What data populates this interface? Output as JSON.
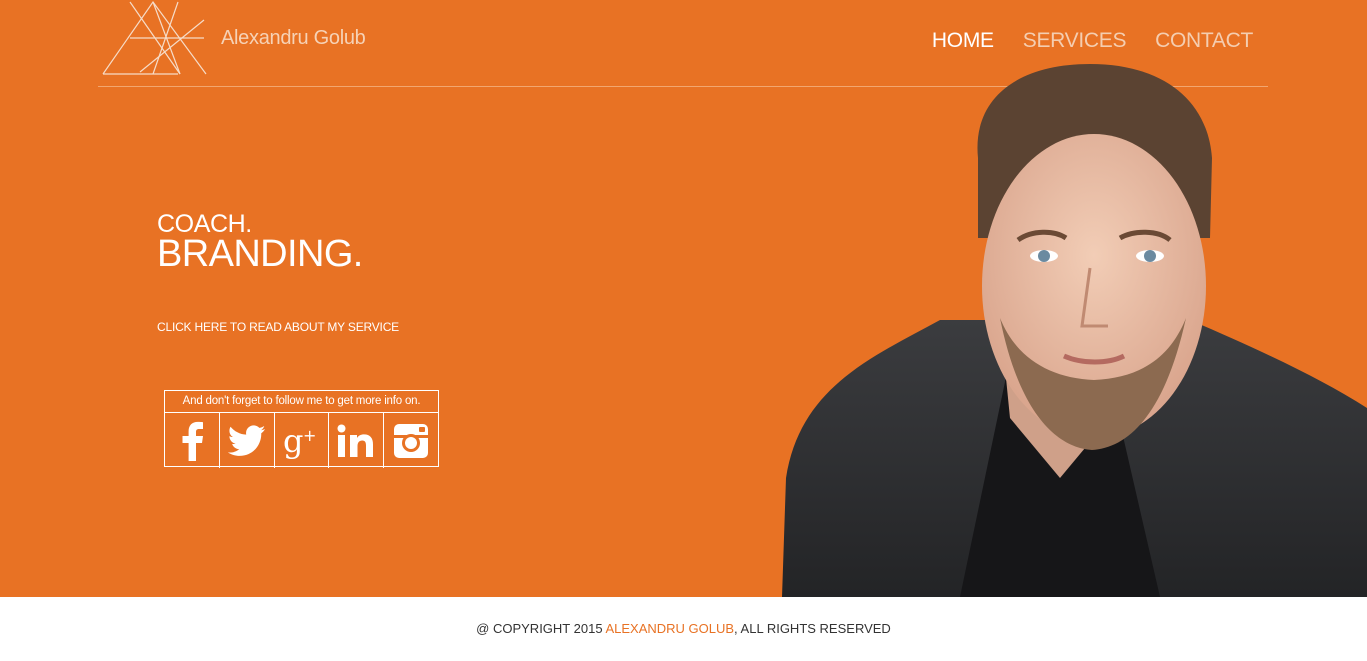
{
  "brand": {
    "name": "Alexandru Golub",
    "logo_icon": "ag-monogram-logo"
  },
  "nav": {
    "items": [
      {
        "label": "HOME",
        "active": true
      },
      {
        "label": "SERVICES",
        "active": false
      },
      {
        "label": "CONTACT",
        "active": false
      }
    ]
  },
  "hero": {
    "tagline_1": "COACH.",
    "tagline_2": "BRANDING.",
    "cta": "CLICK HERE TO READ ABOUT MY SERVICE",
    "follow_text": "And don't forget to follow me to get more info on.",
    "socials": [
      "facebook-icon",
      "twitter-icon",
      "google-plus-icon",
      "linkedin-icon",
      "instagram-icon"
    ],
    "portrait": "portrait-photo"
  },
  "footer": {
    "prefix": "@ COPYRIGHT 2015 ",
    "name": "ALEXANDRU GOLUB",
    "suffix": ", ALL RIGHTS RESERVED"
  },
  "colors": {
    "accent": "#e87224",
    "text_light": "#ffffff",
    "footer_text": "#333333"
  }
}
